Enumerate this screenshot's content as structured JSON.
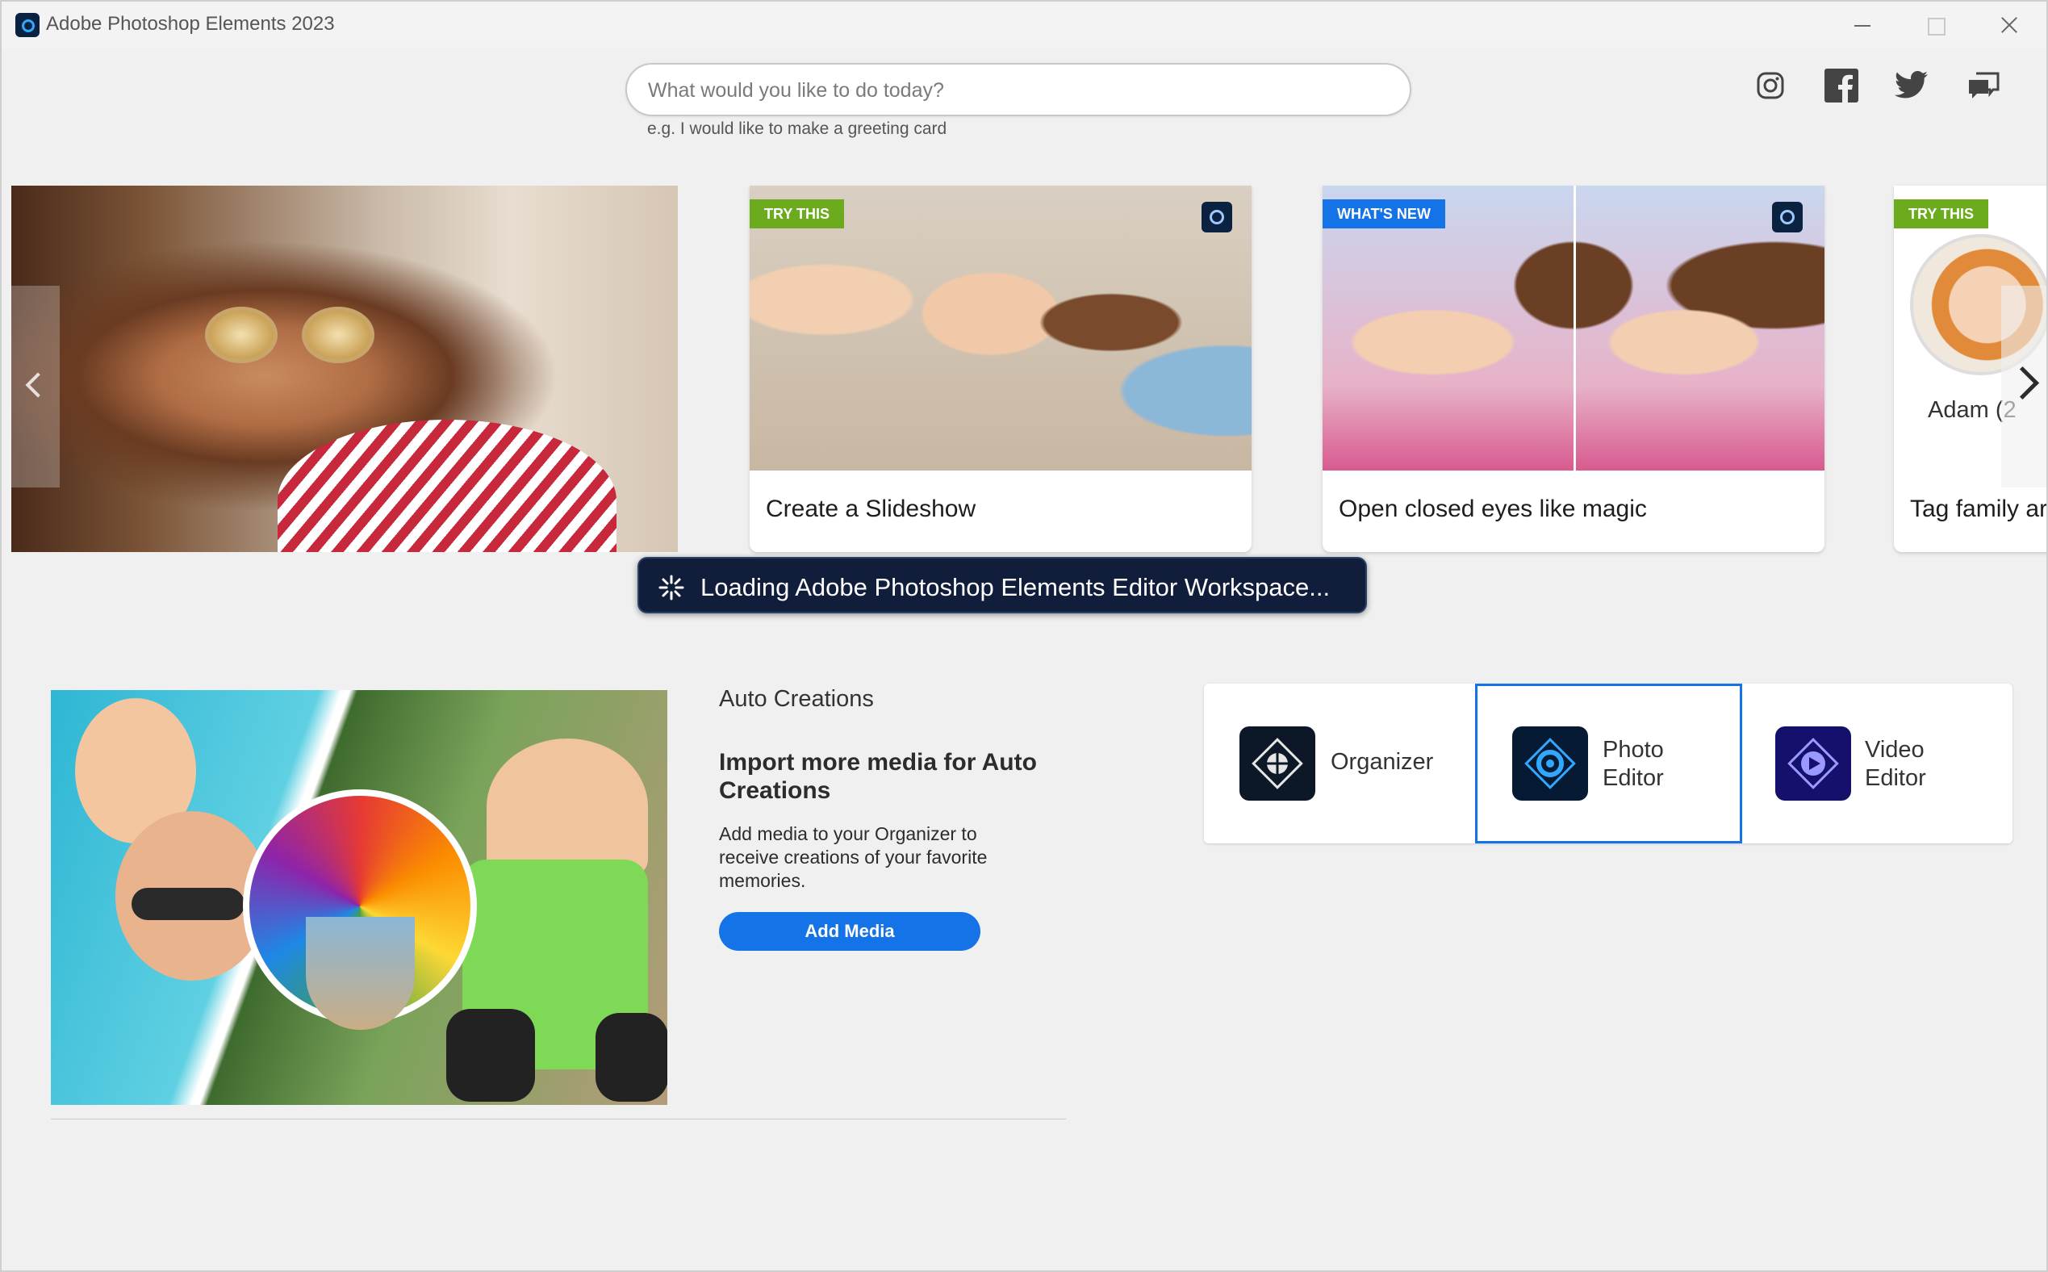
{
  "window": {
    "title": "Adobe Photoshop Elements 2023"
  },
  "search": {
    "placeholder": "What would you like to do today?",
    "hint": "e.g. I would like to make a greeting card"
  },
  "social": [
    "instagram-icon",
    "facebook-icon",
    "twitter-icon",
    "feedback-icon"
  ],
  "carousel": {
    "cards": [
      {
        "badge": "TRY THIS",
        "label": "Create a Slideshow",
        "badge_color": "#6cab1e"
      },
      {
        "badge": "WHAT'S NEW",
        "label": "Open closed eyes like magic",
        "badge_color": "#1473e6"
      },
      {
        "badge": "TRY THIS",
        "label": "Tag family ar",
        "person": "Adam (2",
        "badge_color": "#6cab1e"
      }
    ]
  },
  "loading": {
    "text": "Loading Adobe Photoshop Elements Editor Workspace..."
  },
  "auto_creations": {
    "heading": "Auto Creations",
    "title": "Import more media for Auto Creations",
    "description": "Add media to your Organizer to receive creations of your favorite memories.",
    "button": "Add Media"
  },
  "launcher": {
    "organizer": "Organizer",
    "photo_editor_line1": "Photo",
    "photo_editor_line2": "Editor",
    "video_editor_line1": "Video",
    "video_editor_line2": "Editor"
  },
  "colors": {
    "accent": "#1473e6",
    "try_this_badge": "#6cab1e",
    "toast_bg": "#101e3b"
  }
}
